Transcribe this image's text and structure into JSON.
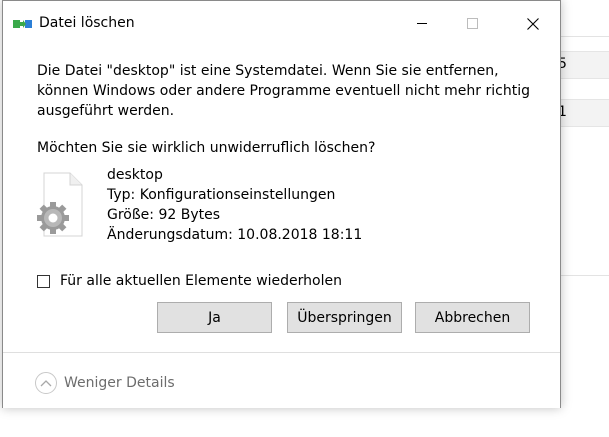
{
  "background": {
    "row_values": [
      "5",
      "1"
    ]
  },
  "dialog": {
    "title": "Datei löschen",
    "message": "Die Datei \"desktop\" ist eine Systemdatei. Wenn Sie sie entfernen, können Windows oder andere Programme eventuell nicht mehr richtig ausgeführt werden.",
    "question": "Möchten Sie sie wirklich unwiderruflich löschen?",
    "file": {
      "name": "desktop",
      "type": "Typ: Konfigurationseinstellungen",
      "size": "Größe: 92 Bytes",
      "modified": "Änderungsdatum: 10.08.2018 18:11",
      "icon": "settings-file-icon"
    },
    "repeat_checkbox": {
      "label": "Für alle aktuellen Elemente wiederholen",
      "checked": false
    },
    "buttons": {
      "yes": "Ja",
      "skip": "Überspringen",
      "cancel": "Abbrechen"
    },
    "details_toggle": "Weniger Details"
  },
  "colors": {
    "accent_green": "#3aa94a",
    "accent_blue": "#2b7fd6",
    "button_face": "#e1e1e1",
    "button_border": "#adadad",
    "muted_text": "#6d6d6d"
  }
}
